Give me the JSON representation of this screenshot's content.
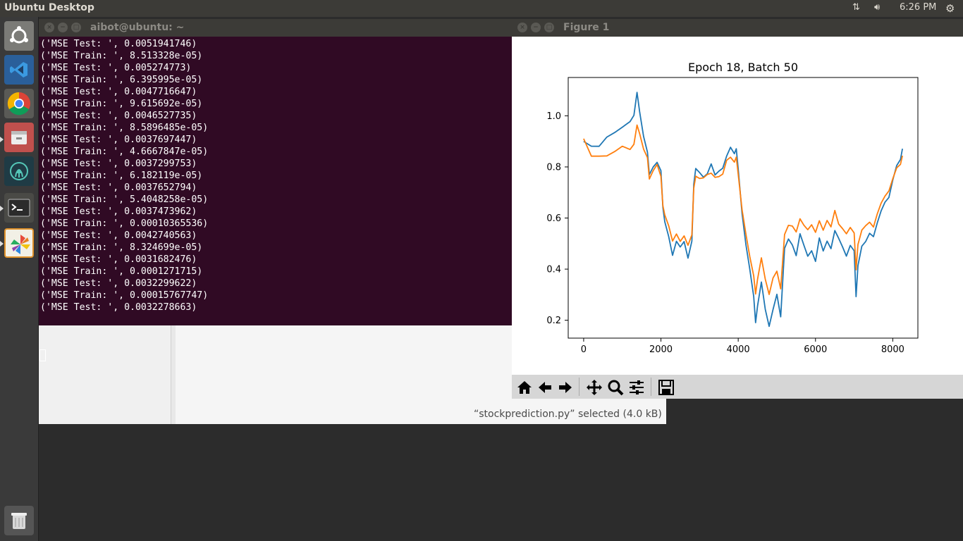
{
  "panel": {
    "title": "Ubuntu Desktop",
    "time": "6:26 PM"
  },
  "launcher": [
    "dash-home-icon",
    "vscode-icon",
    "chrome-icon",
    "files-icon",
    "gitkraken-icon",
    "terminal-icon",
    "pinwheel-icon",
    "trash-icon"
  ],
  "terminal": {
    "title": "aibot@ubuntu: ~",
    "lines": [
      "('MSE Test: ', 0.0051941746)",
      "('MSE Train: ', 8.513328e-05)",
      "('MSE Test: ', 0.005274773)",
      "('MSE Train: ', 6.395995e-05)",
      "('MSE Test: ', 0.0047716647)",
      "('MSE Train: ', 9.615692e-05)",
      "('MSE Test: ', 0.0046527735)",
      "('MSE Train: ', 8.5896485e-05)",
      "('MSE Test: ', 0.0037697447)",
      "('MSE Train: ', 4.6667847e-05)",
      "('MSE Test: ', 0.0037299753)",
      "('MSE Train: ', 6.182119e-05)",
      "('MSE Test: ', 0.0037652794)",
      "('MSE Train: ', 5.4048258e-05)",
      "('MSE Test: ', 0.0037473962)",
      "('MSE Train: ', 0.00010365536)",
      "('MSE Test: ', 0.0042740563)",
      "('MSE Train: ', 8.324699e-05)",
      "('MSE Test: ', 0.0031682476)",
      "('MSE Train: ', 0.0001271715)",
      "('MSE Test: ', 0.0032299622)",
      "('MSE Train: ', 0.00015767747)",
      "('MSE Test: ', 0.0032278663)"
    ]
  },
  "files": {
    "status": "“stockprediction.py” selected  (4.0 kB)"
  },
  "figure": {
    "title": "Figure 1"
  },
  "chart_data": {
    "type": "line",
    "title": "Epoch 18, Batch 50",
    "xlabel": "",
    "ylabel": "",
    "xlim": [
      -400,
      8650
    ],
    "ylim": [
      0.13,
      1.15
    ],
    "xticks": [
      "0",
      "2000",
      "4000",
      "6000",
      "8000"
    ],
    "yticks": [
      "0.2",
      "0.4",
      "0.6",
      "0.8",
      "1.0"
    ],
    "grid": false,
    "series": [
      {
        "color": "#1f77b4",
        "x": [
          0,
          200,
          400,
          600,
          800,
          1000,
          1200,
          1300,
          1380,
          1450,
          1550,
          1650,
          1700,
          1800,
          1900,
          2000,
          2050,
          2100,
          2200,
          2300,
          2400,
          2500,
          2600,
          2700,
          2800,
          2850,
          2900,
          3000,
          3100,
          3200,
          3300,
          3400,
          3500,
          3600,
          3700,
          3800,
          3900,
          3950,
          4000,
          4100,
          4200,
          4300,
          4400,
          4450,
          4500,
          4600,
          4700,
          4800,
          4900,
          5000,
          5100,
          5200,
          5300,
          5400,
          5500,
          5600,
          5700,
          5800,
          5900,
          6000,
          6100,
          6200,
          6300,
          6400,
          6500,
          6600,
          6700,
          6800,
          6900,
          7000,
          7050,
          7100,
          7200,
          7300,
          7400,
          7500,
          7600,
          7700,
          7800,
          7900,
          8000,
          8100,
          8200,
          8250
        ],
        "y": [
          0.9,
          0.87,
          0.88,
          0.91,
          0.93,
          0.95,
          0.97,
          1.0,
          1.1,
          1.02,
          0.92,
          0.86,
          0.78,
          0.8,
          0.82,
          0.78,
          0.63,
          0.58,
          0.52,
          0.45,
          0.5,
          0.48,
          0.5,
          0.45,
          0.52,
          0.74,
          0.8,
          0.79,
          0.77,
          0.78,
          0.8,
          0.76,
          0.78,
          0.79,
          0.84,
          0.87,
          0.84,
          0.86,
          0.8,
          0.62,
          0.5,
          0.4,
          0.3,
          0.2,
          0.26,
          0.34,
          0.24,
          0.17,
          0.24,
          0.3,
          0.21,
          0.48,
          0.52,
          0.5,
          0.46,
          0.54,
          0.5,
          0.46,
          0.48,
          0.44,
          0.52,
          0.47,
          0.5,
          0.48,
          0.55,
          0.52,
          0.48,
          0.46,
          0.5,
          0.48,
          0.3,
          0.42,
          0.5,
          0.52,
          0.55,
          0.52,
          0.58,
          0.62,
          0.66,
          0.68,
          0.74,
          0.8,
          0.84,
          0.88
        ]
      },
      {
        "color": "#ff7f0e",
        "x": [
          0,
          200,
          400,
          600,
          800,
          1000,
          1200,
          1300,
          1380,
          1450,
          1550,
          1650,
          1700,
          1800,
          1900,
          2000,
          2050,
          2100,
          2200,
          2300,
          2400,
          2500,
          2600,
          2700,
          2800,
          2850,
          2900,
          3000,
          3100,
          3200,
          3300,
          3400,
          3500,
          3600,
          3700,
          3800,
          3900,
          3950,
          4000,
          4100,
          4200,
          4300,
          4400,
          4450,
          4500,
          4600,
          4700,
          4800,
          4900,
          5000,
          5100,
          5200,
          5300,
          5400,
          5500,
          5600,
          5700,
          5800,
          5900,
          6000,
          6100,
          6200,
          6300,
          6400,
          6500,
          6600,
          6700,
          6800,
          6900,
          7000,
          7050,
          7100,
          7200,
          7300,
          7400,
          7500,
          7600,
          7700,
          7800,
          7900,
          8000,
          8100,
          8200,
          8250
        ],
        "y": [
          0.9,
          0.84,
          0.84,
          0.84,
          0.85,
          0.87,
          0.88,
          0.9,
          0.97,
          0.93,
          0.88,
          0.84,
          0.76,
          0.78,
          0.8,
          0.76,
          0.64,
          0.6,
          0.56,
          0.5,
          0.54,
          0.52,
          0.54,
          0.5,
          0.54,
          0.72,
          0.77,
          0.76,
          0.75,
          0.76,
          0.77,
          0.75,
          0.76,
          0.77,
          0.82,
          0.85,
          0.82,
          0.84,
          0.78,
          0.64,
          0.54,
          0.46,
          0.38,
          0.3,
          0.36,
          0.44,
          0.36,
          0.3,
          0.36,
          0.38,
          0.33,
          0.54,
          0.58,
          0.58,
          0.55,
          0.6,
          0.58,
          0.55,
          0.57,
          0.54,
          0.58,
          0.55,
          0.58,
          0.56,
          0.62,
          0.58,
          0.56,
          0.54,
          0.57,
          0.55,
          0.4,
          0.5,
          0.55,
          0.57,
          0.58,
          0.56,
          0.61,
          0.65,
          0.68,
          0.7,
          0.76,
          0.8,
          0.82,
          0.85
        ]
      }
    ]
  }
}
